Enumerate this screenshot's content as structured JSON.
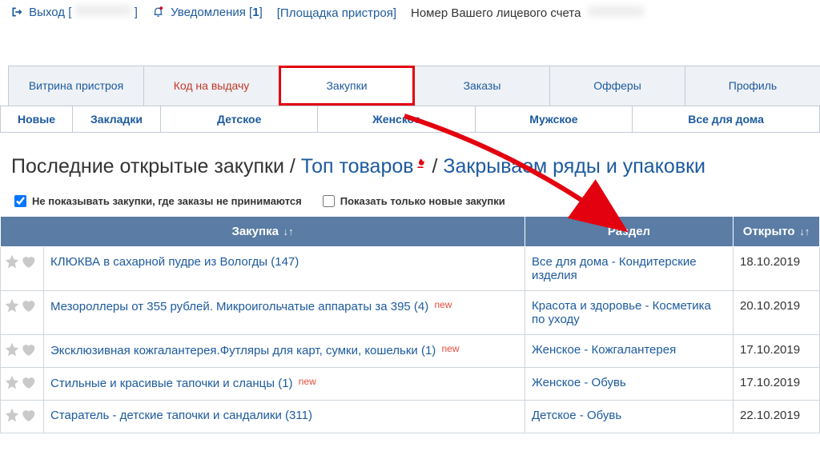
{
  "topbar": {
    "exit": "Выход",
    "notifications": "Уведомления",
    "notif_count": "1",
    "area": "[Площадка пристроя]",
    "account_label": "Номер Вашего лицевого счета"
  },
  "tabs": {
    "main": [
      "Витрина пристроя",
      "Код на выдачу",
      "Закупки",
      "Заказы",
      "Офферы",
      "Профиль"
    ],
    "sub": [
      "Новые",
      "Закладки",
      "Детское",
      "Женское",
      "Мужское",
      "Все для дома"
    ]
  },
  "heading": {
    "prefix": "Последние открытые закупки / ",
    "top": "Топ товаров",
    "sep": " / ",
    "close": "Закрываем ряды и упаковки"
  },
  "checks": {
    "hide": "Не показывать закупки, где заказы не принимаются",
    "new_only": "Показать только новые закупки"
  },
  "table": {
    "headers": {
      "name": "Закупка",
      "section": "Раздел",
      "opened": "Открыто"
    },
    "rows": [
      {
        "name": "КЛЮКВА в сахарной пудре из Вологды (147)",
        "section": "Все для дома - Кондитерские изделия",
        "opened": "18.10.2019",
        "new": false
      },
      {
        "name": "Мезороллеры от 355 рублей. Микроигольчатые аппараты за 395 (4)",
        "section": "Красота и здоровье - Косметика по уходу",
        "opened": "20.10.2019",
        "new": true
      },
      {
        "name": "Эксклюзивная кожгалантерея.Футляры для карт, сумки, кошельки (1)",
        "section": "Женское - Кожгалантерея",
        "opened": "17.10.2019",
        "new": true
      },
      {
        "name": "Стильные и красивые тапочки и сланцы (1)",
        "section": "Женское - Обувь",
        "opened": "17.10.2019",
        "new": true
      },
      {
        "name": "Старатель - детские тапочки и сандалики (311)",
        "section": "Детское - Обувь",
        "opened": "22.10.2019",
        "new": false
      }
    ]
  },
  "badges": {
    "new": "new"
  }
}
